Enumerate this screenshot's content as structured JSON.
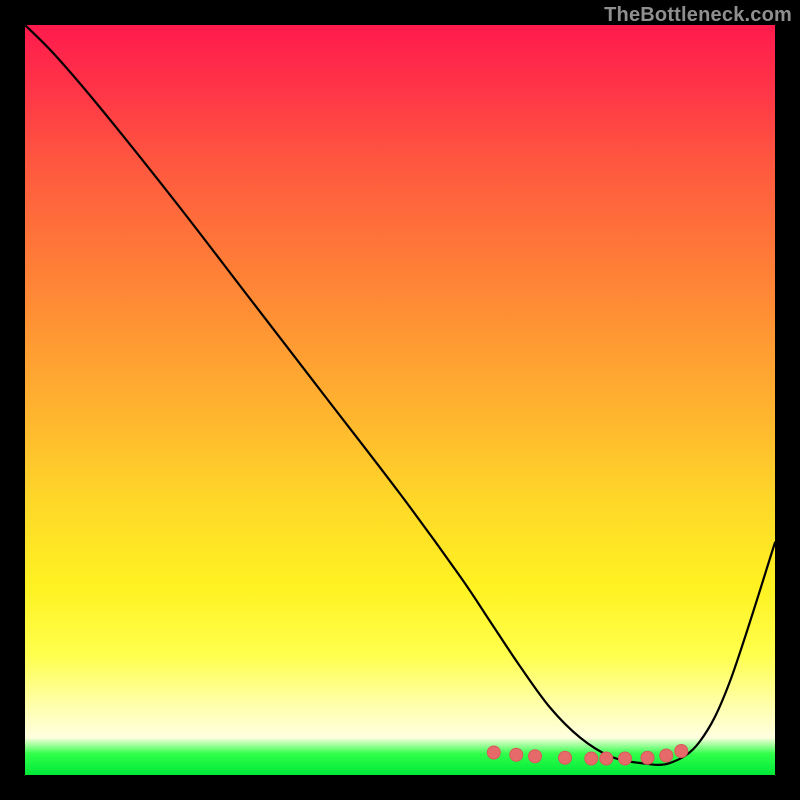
{
  "watermark": "TheBottleneck.com",
  "colors": {
    "background": "#000000",
    "curve": "#000000",
    "marker_fill": "#e76a6a",
    "marker_stroke": "#d85b5b"
  },
  "chart_data": {
    "type": "line",
    "title": "",
    "xlabel": "",
    "ylabel": "",
    "xlim": [
      0,
      100
    ],
    "ylim": [
      0,
      100
    ],
    "series": [
      {
        "name": "bottleneck-curve",
        "x": [
          0,
          4,
          10,
          20,
          30,
          40,
          50,
          58,
          62,
          66,
          70,
          74,
          78,
          82,
          86,
          90,
          94,
          100
        ],
        "y": [
          100,
          96,
          89,
          76.5,
          63.5,
          50.5,
          37.5,
          26.5,
          20.5,
          14.5,
          9.0,
          5.0,
          2.5,
          1.6,
          1.6,
          4.5,
          12.5,
          31.0
        ]
      }
    ],
    "markers": {
      "name": "trough-markers",
      "x": [
        62.5,
        65.5,
        68.0,
        72.0,
        75.5,
        77.5,
        80.0,
        83.0,
        85.5,
        87.5
      ],
      "y": [
        3.0,
        2.7,
        2.5,
        2.3,
        2.2,
        2.2,
        2.2,
        2.3,
        2.6,
        3.2
      ]
    }
  }
}
